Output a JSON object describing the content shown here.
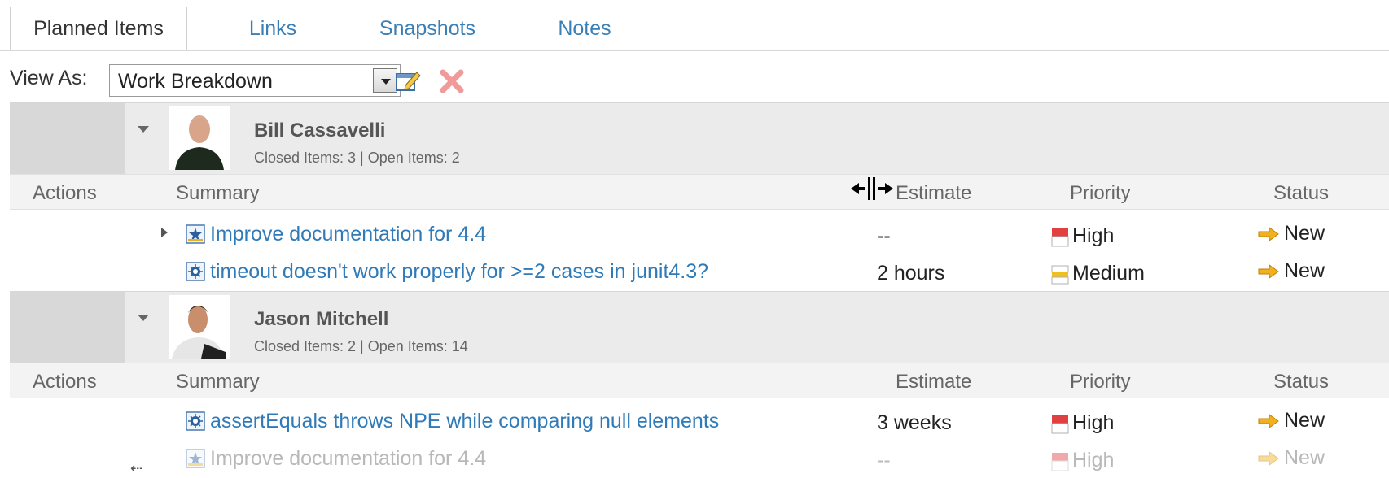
{
  "tabs": [
    {
      "label": "Planned Items",
      "active": true
    },
    {
      "label": "Links",
      "active": false
    },
    {
      "label": "Snapshots",
      "active": false
    },
    {
      "label": "Notes",
      "active": false
    }
  ],
  "toolbar": {
    "view_as_label": "View As:",
    "view_as_value": "Work Breakdown",
    "edit_icon": "edit-view-icon",
    "delete_icon": "delete-view-icon"
  },
  "columns": {
    "actions": "Actions",
    "summary": "Summary",
    "estimate": "Estimate",
    "priority": "Priority",
    "status": "Status"
  },
  "groups": [
    {
      "name": "Bill Cassavelli",
      "stats": "Closed Items: 3 | Open Items: 2",
      "items": [
        {
          "summary": "Improve documentation for 4.4",
          "estimate": "--",
          "priority": "High",
          "status": "New",
          "type": "story-icon"
        },
        {
          "summary": "timeout doesn't work properly for >=2 cases in junit4.3?",
          "estimate": "2 hours",
          "priority": "Medium",
          "status": "New",
          "type": "defect-icon"
        }
      ]
    },
    {
      "name": "Jason Mitchell",
      "stats": "Closed Items: 2 | Open Items: 14",
      "items": [
        {
          "summary": "assertEquals throws NPE while comparing null elements",
          "estimate": "3 weeks",
          "priority": "High",
          "status": "New",
          "type": "defect-icon"
        },
        {
          "summary": "Improve documentation for 4.4",
          "estimate": "--",
          "priority": "High",
          "status": "New",
          "type": "story-icon",
          "dragging": true
        }
      ]
    }
  ],
  "colors": {
    "link": "#2f7ab8",
    "header_bg": "#ebebeb",
    "priority_high": "#e04040",
    "priority_medium": "#f0c020",
    "status_arrow": "#f0b020"
  }
}
